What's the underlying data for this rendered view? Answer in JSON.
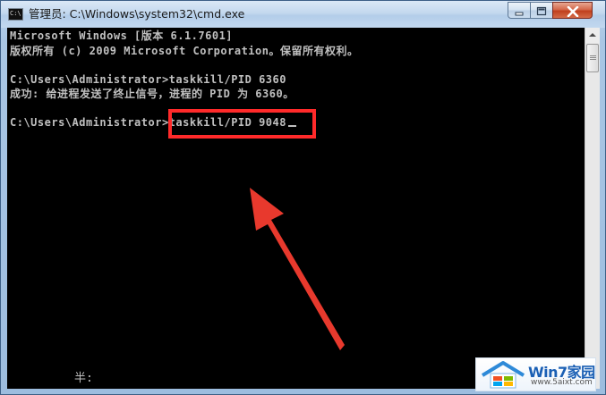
{
  "window": {
    "title": "管理员: C:\\Windows\\system32\\cmd.exe",
    "icon": "cmd-icon",
    "controls": [
      "minimize-icon",
      "maximize-icon",
      "close-icon"
    ]
  },
  "console": {
    "lines": [
      "Microsoft Windows [版本 6.1.7601]",
      "版权所有 (c) 2009 Microsoft Corporation。保留所有权利。",
      "",
      "C:\\Users\\Administrator>taskkill/PID 6360",
      "成功: 给进程发送了终止信号，进程的 PID 为 6360。",
      "",
      "C:\\Users\\Administrator>taskkill/PID 9048"
    ],
    "ime_status": "半:"
  },
  "annotations": {
    "highlight_color": "#ff2a2a",
    "arrow_color": "#e8392d"
  },
  "watermark": {
    "title": "Win7家园",
    "url": "www.5aixt.com"
  },
  "colors": {
    "console_bg": "#000000",
    "console_text": "#c0c0c0",
    "titlebar": "#c3d8ee"
  }
}
